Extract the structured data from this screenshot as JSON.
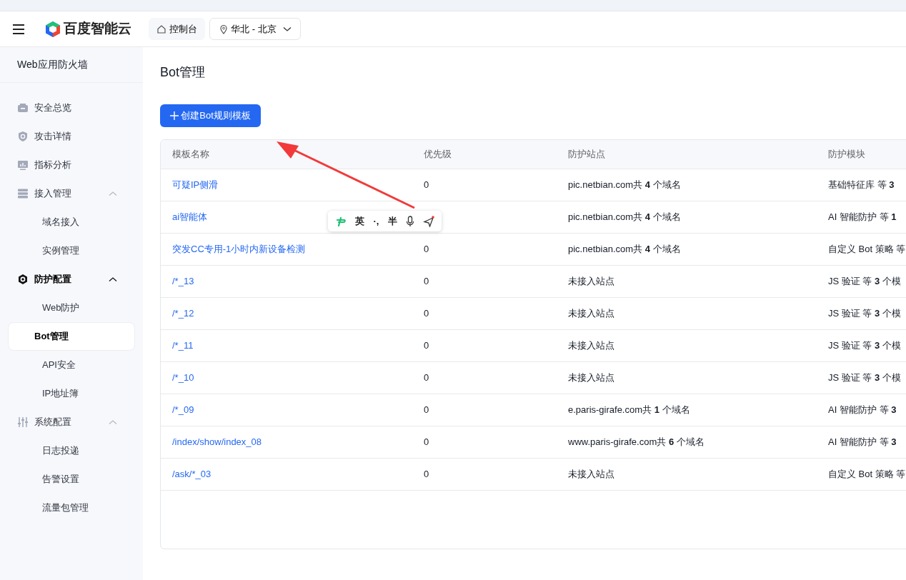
{
  "header": {
    "brand": "百度智能云",
    "console_button": "控制台",
    "region": "华北 - 北京"
  },
  "sidebar": {
    "title": "Web应用防火墙",
    "items": [
      {
        "label": "安全总览",
        "selected": false
      },
      {
        "label": "攻击详情",
        "selected": false
      },
      {
        "label": "指标分析",
        "selected": false
      },
      {
        "label": "接入管理",
        "selected": false,
        "expanded": true,
        "children": [
          {
            "label": "域名接入",
            "selected": false
          },
          {
            "label": "实例管理",
            "selected": false
          }
        ]
      },
      {
        "label": "防护配置",
        "selected": false,
        "expanded": true,
        "children": [
          {
            "label": "Web防护",
            "selected": false
          },
          {
            "label": "Bot管理",
            "selected": true
          },
          {
            "label": "API安全",
            "selected": false
          },
          {
            "label": "IP地址簿",
            "selected": false
          }
        ]
      },
      {
        "label": "系统配置",
        "selected": false,
        "expanded": true,
        "children": [
          {
            "label": "日志投递",
            "selected": false
          },
          {
            "label": "告警设置",
            "selected": false
          },
          {
            "label": "流量包管理",
            "selected": false
          }
        ]
      }
    ]
  },
  "page": {
    "title": "Bot管理",
    "create_button": "创建Bot规则模板"
  },
  "table": {
    "columns": [
      "模板名称",
      "优先级",
      "防护站点",
      "防护模块"
    ],
    "rows": [
      {
        "name": "可疑IP侧滑",
        "priority": "0",
        "site": "pic.netbian.com共 **4** 个域名",
        "module": "基础特征库 等 **3**"
      },
      {
        "name": "ai智能体",
        "site": "pic.netbian.com共 **4** 个域名",
        "module": "AI 智能防护 等 **1**"
      },
      {
        "name": "突发CC专用-1小时内新设备检测",
        "priority": "0",
        "site": "pic.netbian.com共 **4** 个域名",
        "module": "自定义 Bot 策略 等"
      },
      {
        "name": "/*_13",
        "priority": "0",
        "site": "未接入站点",
        "module": "JS 验证 等 **3** 个模"
      },
      {
        "name": "/*_12",
        "priority": "0",
        "site": "未接入站点",
        "module": "JS 验证 等 **3** 个模"
      },
      {
        "name": "/*_11",
        "priority": "0",
        "site": "未接入站点",
        "module": "JS 验证 等 **3** 个模"
      },
      {
        "name": "/*_10",
        "priority": "0",
        "site": "未接入站点",
        "module": "JS 验证 等 **3** 个模"
      },
      {
        "name": "/*_09",
        "priority": "0",
        "site": "e.paris-girafe.com共 **1** 个域名",
        "module": "AI 智能防护 等 **3**"
      },
      {
        "name": "/index/show/index_08",
        "priority": "0",
        "site": "www.paris-girafe.com共 **6** 个域名",
        "module": "AI 智能防护 等 **3**"
      },
      {
        "name": "/ask/*_03",
        "priority": "0",
        "site": "未接入站点",
        "module": "自定义 Bot 策略 等"
      }
    ]
  },
  "ime_toolbar": {
    "language": "英",
    "punctuation": "·,",
    "width": "半"
  }
}
